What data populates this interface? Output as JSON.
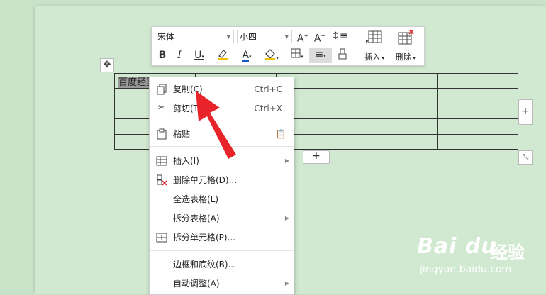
{
  "toolbar": {
    "font_name": "宋体",
    "font_size": "小四",
    "insert_label": "插入",
    "delete_label": "删除",
    "font_color": "#1a56c4",
    "highlight_color": "#f0c000"
  },
  "table": {
    "cell_text": "百度经验"
  },
  "context_menu": {
    "items": [
      {
        "label": "复制(C)",
        "shortcut": "Ctrl+C",
        "icon": "copy-icon"
      },
      {
        "label": "剪切(T)",
        "shortcut": "Ctrl+X",
        "icon": "cut-icon"
      },
      {
        "label": "粘贴",
        "icon": "paste-icon"
      },
      {
        "label": "插入(I)",
        "icon": "table-insert-icon",
        "submenu": true
      },
      {
        "label": "删除单元格(D)...",
        "icon": "delete-cell-icon"
      },
      {
        "label": "全选表格(L)"
      },
      {
        "label": "拆分表格(A)",
        "submenu": true
      },
      {
        "label": "拆分单元格(P)...",
        "icon": "split-cell-icon"
      },
      {
        "label": "边框和底纹(B)..."
      },
      {
        "label": "自动调整(A)",
        "submenu": true
      }
    ]
  },
  "watermark": {
    "logo": "Bai du",
    "brand": "经验",
    "url": "jingyan.baidu.com"
  },
  "annotation": {
    "arrow_color": "#e8232a"
  }
}
